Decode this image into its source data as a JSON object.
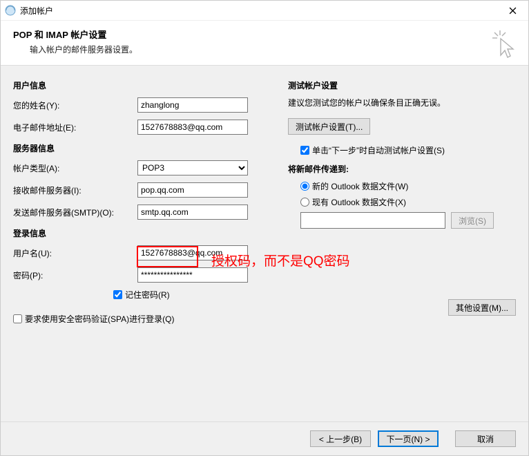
{
  "window": {
    "title": "添加帐户"
  },
  "header": {
    "heading": "POP 和 IMAP 帐户设置",
    "sub": "输入帐户的邮件服务器设置。"
  },
  "userInfo": {
    "title": "用户信息",
    "nameLabel": "您的姓名(Y):",
    "nameValue": "zhanglong",
    "emailLabel": "电子邮件地址(E):",
    "emailValue": "1527678883@qq.com"
  },
  "serverInfo": {
    "title": "服务器信息",
    "typeLabel": "帐户类型(A):",
    "typeValue": "POP3",
    "incomingLabel": "接收邮件服务器(I):",
    "incomingValue": "pop.qq.com",
    "outgoingLabel": "发送邮件服务器(SMTP)(O):",
    "outgoingValue": "smtp.qq.com"
  },
  "loginInfo": {
    "title": "登录信息",
    "userLabel": "用户名(U):",
    "userValue": "1527678883@qq.com",
    "passLabel": "密码(P):",
    "passValue": "****************",
    "rememberLabel": "记住密码(R)",
    "rememberChecked": true,
    "spaLabel": "要求使用安全密码验证(SPA)进行登录(Q)",
    "spaChecked": false
  },
  "testAccount": {
    "title": "测试帐户设置",
    "desc": "建议您测试您的帐户以确保条目正确无误。",
    "buttonLabel": "测试帐户设置(T)...",
    "autoTestLabel": "单击“下一步”时自动测试帐户设置(S)",
    "autoTestChecked": true,
    "deliverTitle": "将新邮件传递到:",
    "newFileLabel": "新的 Outlook 数据文件(W)",
    "existingFileLabel": "现有 Outlook 数据文件(X)",
    "browseLabel": "浏览(S)",
    "deliverSelected": "new"
  },
  "otherSettings": {
    "label": "其他设置(M)..."
  },
  "footer": {
    "back": "< 上一步(B)",
    "next": "下一页(N) >",
    "cancel": "取消"
  },
  "annotation": {
    "text": "授权码，而不是QQ密码"
  }
}
